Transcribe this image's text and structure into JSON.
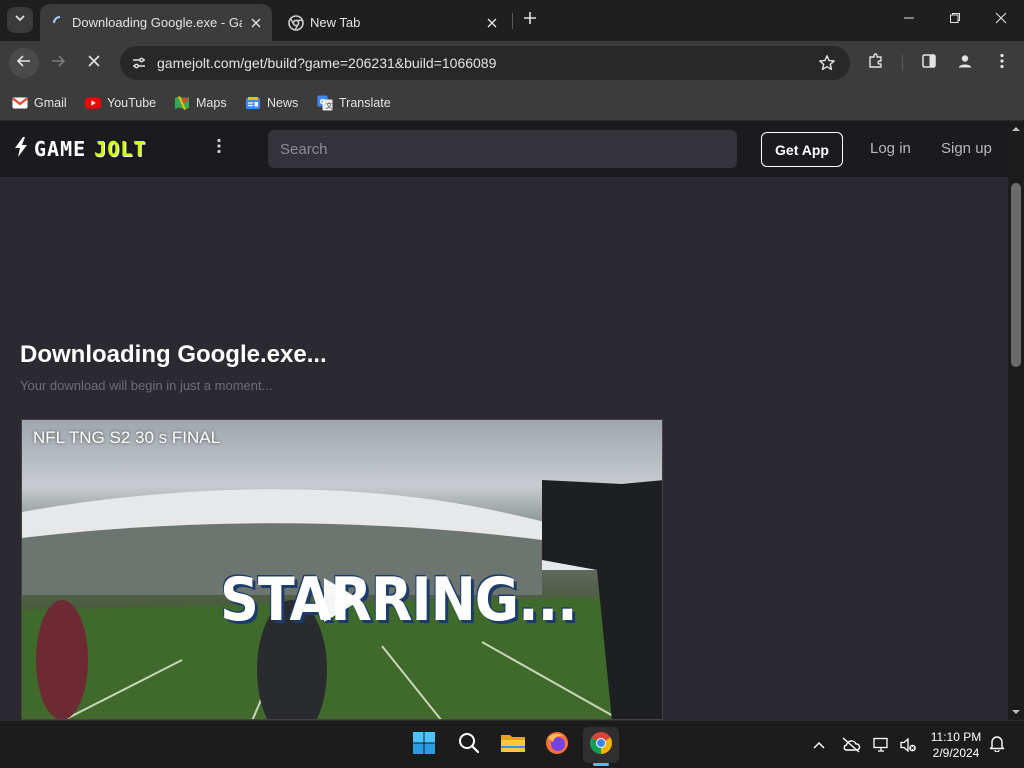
{
  "browser": {
    "tabs": [
      {
        "title": "Downloading Google.exe - Game Jolt",
        "active": true,
        "loading": true
      },
      {
        "title": "New Tab",
        "active": false
      }
    ],
    "address_bar": {
      "url": "gamejolt.com/get/build?game=206231&build=1066089"
    },
    "bookmarks": [
      {
        "label": "Gmail",
        "icon": "gmail-icon"
      },
      {
        "label": "YouTube",
        "icon": "youtube-icon"
      },
      {
        "label": "Maps",
        "icon": "maps-icon"
      },
      {
        "label": "News",
        "icon": "news-icon"
      },
      {
        "label": "Translate",
        "icon": "translate-icon"
      }
    ]
  },
  "site": {
    "logo_left": "GAME",
    "logo_right": "JOLT",
    "search_placeholder": "Search",
    "get_app": "Get App",
    "login": "Log in",
    "signup": "Sign up"
  },
  "main": {
    "heading": "Downloading Google.exe...",
    "subheading": "Your download will begin in just a moment...",
    "video": {
      "title": "NFL TNG S2 30 s FINAL",
      "caption": "STARRING..."
    }
  },
  "taskbar": {
    "time": "11:10 PM",
    "date": "2/9/2024",
    "apps": [
      "start-icon",
      "search-icon",
      "file-explorer-icon",
      "firefox-icon",
      "chrome-icon"
    ]
  },
  "colors": {
    "page_bg": "#2c2a31",
    "header_bg": "#1b1a1e",
    "gamejolt_accent": "#ccff00",
    "taskbar_indicator": "#4cc2ff"
  }
}
